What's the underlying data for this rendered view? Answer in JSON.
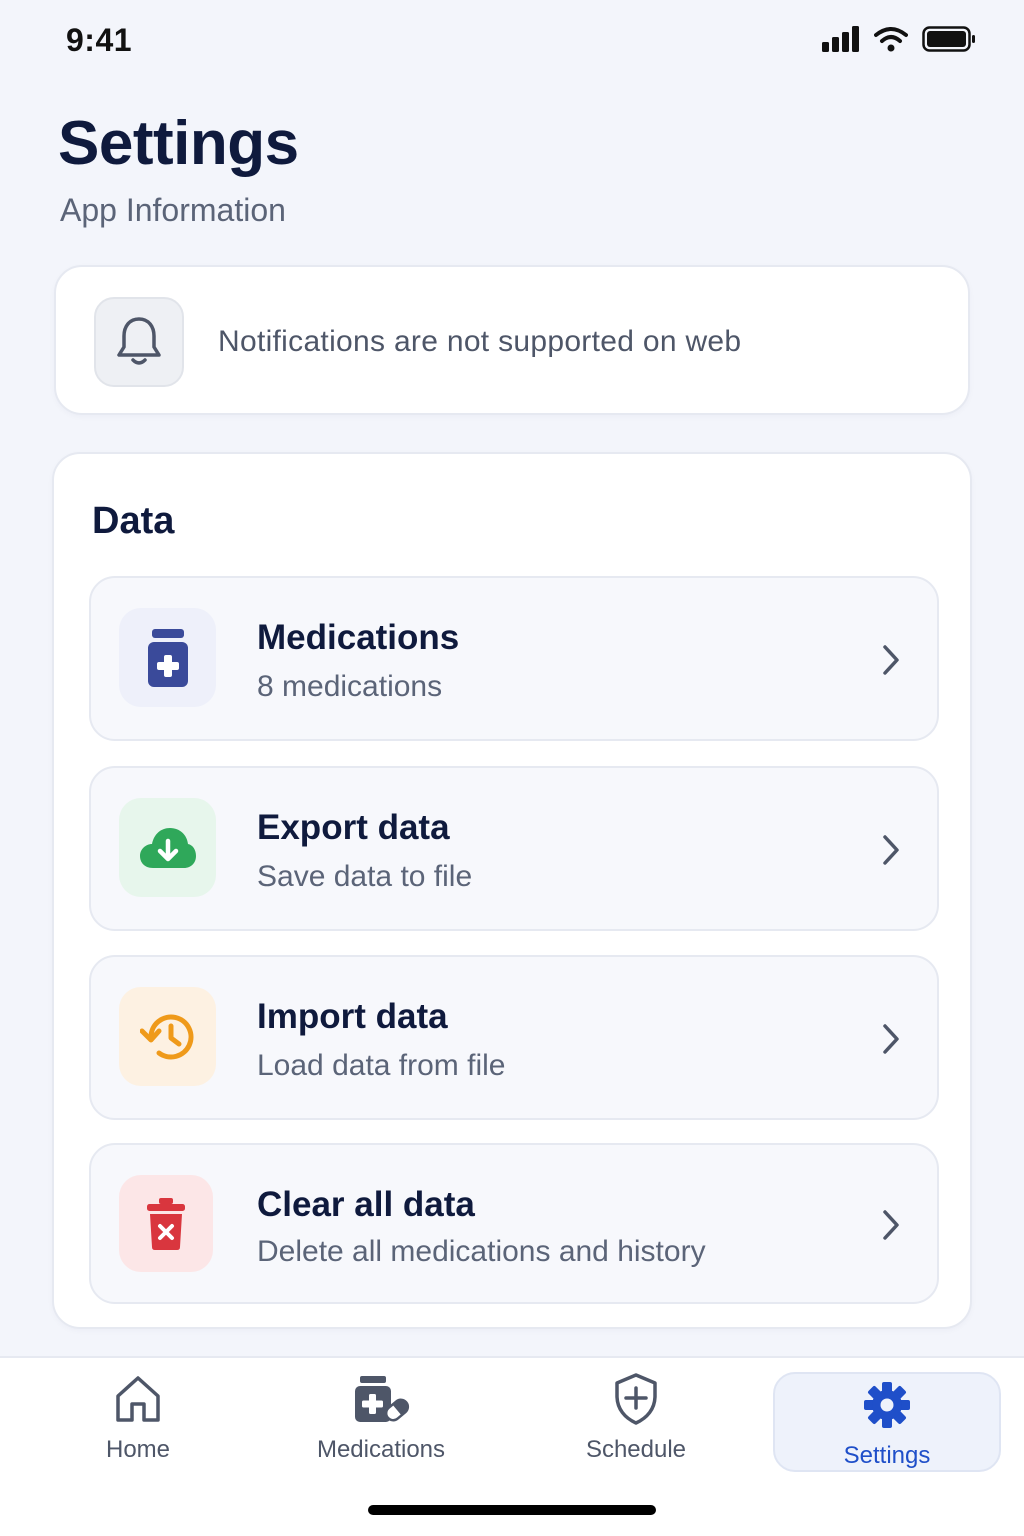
{
  "status_bar": {
    "time": "9:41"
  },
  "header": {
    "title": "Settings",
    "subtitle": "App Information"
  },
  "notification_card": {
    "icon": "bell-icon",
    "text": "Notifications are not supported on web"
  },
  "data_section": {
    "title": "Data",
    "rows": [
      {
        "title": "Medications",
        "subtitle": "8 medications",
        "icon": "medicine-bottle-icon",
        "icon_color": "#3a4a9a",
        "icon_bg": "#eef0fa"
      },
      {
        "title": "Export data",
        "subtitle": "Save data to file",
        "icon": "cloud-download-icon",
        "icon_color": "#2fa85a",
        "icon_bg": "#e7f6ec"
      },
      {
        "title": "Import data",
        "subtitle": "Load data from file",
        "icon": "history-icon",
        "icon_color": "#ef9a1a",
        "icon_bg": "#fdf1e2"
      },
      {
        "title": "Clear all data",
        "subtitle": "Delete all medications and history",
        "icon": "trash-icon",
        "icon_color": "#d9363e",
        "icon_bg": "#fce6e7"
      }
    ]
  },
  "bottom_nav": {
    "items": [
      {
        "label": "Home",
        "icon": "home-icon"
      },
      {
        "label": "Medications",
        "icon": "medications-icon"
      },
      {
        "label": "Schedule",
        "icon": "shield-plus-icon"
      },
      {
        "label": "Settings",
        "icon": "gear-icon",
        "active": true
      }
    ],
    "active_color": "#1f4fc9"
  }
}
